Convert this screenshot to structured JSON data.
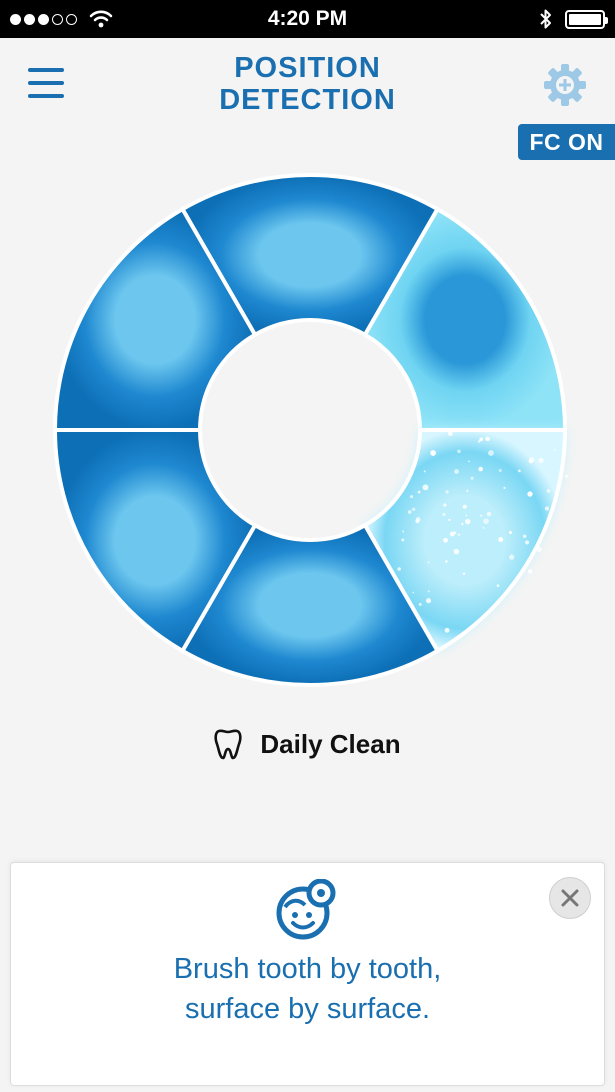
{
  "status_bar": {
    "time": "4:20 PM",
    "signal_bars_filled": 3,
    "signal_bars_total": 5,
    "battery_level": 1.0,
    "icons": [
      "wifi-icon",
      "bluetooth-icon",
      "battery-icon"
    ]
  },
  "header": {
    "title_line1": "POSITION",
    "title_line2": "DETECTION",
    "menu_icon": "hamburger-menu-icon",
    "settings_icon": "gear-plus-icon",
    "badge": "FC ON"
  },
  "ring": {
    "segments_total": 6,
    "segments": [
      {
        "name": "top",
        "state": "pending"
      },
      {
        "name": "upper-right",
        "state": "active"
      },
      {
        "name": "lower-right",
        "state": "cleaning"
      },
      {
        "name": "bottom",
        "state": "pending"
      },
      {
        "name": "lower-left",
        "state": "pending"
      },
      {
        "name": "upper-left",
        "state": "pending"
      }
    ]
  },
  "mode": {
    "icon": "tooth-icon",
    "label": "Daily Clean"
  },
  "tip": {
    "icon": "smiley-dentist-icon",
    "line1": "Brush tooth by tooth,",
    "line2": "surface by surface.",
    "close_icon": "close-icon"
  },
  "colors": {
    "brand_blue": "#1a6fb0",
    "segment_blue": "#1e88d0",
    "segment_light": "#6fd4f2",
    "background": "#f4f4f4"
  }
}
